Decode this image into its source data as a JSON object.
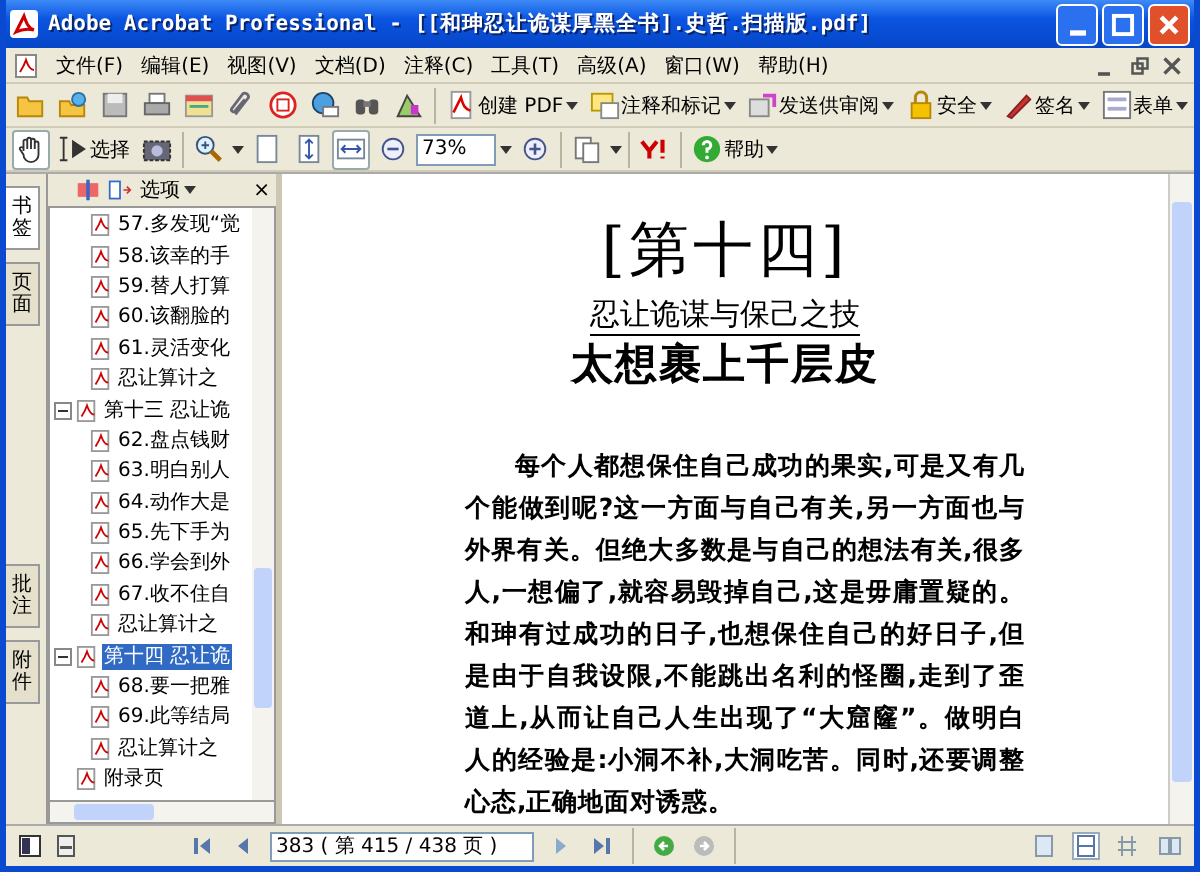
{
  "window": {
    "title": "Adobe Acrobat Professional - [[和珅忍让诡谋厚黑全书].史哲.扫描版.pdf]"
  },
  "menu": [
    "文件(F)",
    "编辑(E)",
    "视图(V)",
    "文档(D)",
    "注释(C)",
    "工具(T)",
    "高级(A)",
    "窗口(W)",
    "帮助(H)"
  ],
  "task_buttons": [
    {
      "kind": "pdf",
      "label": "创建 PDF"
    },
    {
      "kind": "comment",
      "label": "注释和标记"
    },
    {
      "kind": "review",
      "label": "发送供审阅"
    },
    {
      "kind": "lock",
      "label": "安全"
    },
    {
      "kind": "pen",
      "label": "签名"
    },
    {
      "kind": "form",
      "label": "表单"
    }
  ],
  "tools": {
    "select_label": "选择",
    "zoom_value": "73%",
    "help_label": "帮助"
  },
  "side_tabs": [
    {
      "label": "书签",
      "selected": true
    },
    {
      "label": "页面",
      "selected": false
    },
    {
      "label": "批注",
      "selected": false
    },
    {
      "label": "附件",
      "selected": false
    }
  ],
  "bookmarks": {
    "options_label": "选项",
    "close": "×",
    "tree": [
      {
        "children": [
          {
            "label": "57.多发现“觉",
            "selected": false
          },
          {
            "label": "58.该幸的手",
            "selected": false
          },
          {
            "label": "59.替人打算",
            "selected": false
          },
          {
            "label": "60.该翻脸的",
            "selected": false
          },
          {
            "label": "61.灵活变化",
            "selected": false
          },
          {
            "label": "忍让算计之",
            "selected": false
          }
        ]
      },
      {
        "label": "第十三 忍让诡",
        "selected": false,
        "expanded": true,
        "children": [
          {
            "label": "62.盘点钱财",
            "selected": false
          },
          {
            "label": "63.明白别人",
            "selected": false
          },
          {
            "label": "64.动作大是",
            "selected": false
          },
          {
            "label": "65.先下手为",
            "selected": false
          },
          {
            "label": "66.学会到外",
            "selected": false
          },
          {
            "label": "67.收不住自",
            "selected": false
          },
          {
            "label": "忍让算计之",
            "selected": false
          }
        ]
      },
      {
        "label": "第十四 忍让诡",
        "selected": true,
        "expanded": true,
        "children": [
          {
            "label": "68.要一把雅",
            "selected": false
          },
          {
            "label": "69.此等结局",
            "selected": false
          },
          {
            "label": "忍让算计之",
            "selected": false
          }
        ]
      },
      {
        "label": "附录页",
        "selected": false
      }
    ]
  },
  "document": {
    "chapter": "[第十四]",
    "subtitle": "忍让诡谋与保己之技",
    "heading": "太想裹上千层皮",
    "paragraph": "每个人都想保住自己成功的果实,可是又有几个能做到呢?这一方面与自己有关,另一方面也与外界有关。但绝大多数是与自己的想法有关,很多人,一想偏了,就容易毁掉自己,这是毋庸置疑的。和珅有过成功的日子,也想保住自己的好日子,但是由于自我设限,不能跳出名利的怪圈,走到了歪道上,从而让自己人生出现了“大窟窿”。做明白人的经验是:小洞不补,大洞吃苦。同时,还要调整心态,正确地面对诱惑。"
  },
  "status_bar": {
    "page_field": "383 ( 第 415 / 438 页 )"
  }
}
